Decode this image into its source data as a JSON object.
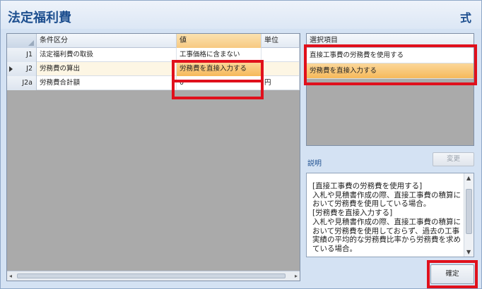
{
  "window": {
    "title": "法定福利費",
    "title_right": "式"
  },
  "grid": {
    "columns": [
      "条件区分",
      "値",
      "単位"
    ],
    "rows": [
      {
        "id": "J1",
        "name": "法定福利費の取扱",
        "value": "工事価格に含まない",
        "unit": ""
      },
      {
        "id": "J2",
        "name": "労務費の算出",
        "value": "労務費を直接入力する",
        "unit": ""
      },
      {
        "id": "J2a",
        "name": "労務費合計額",
        "value": "0",
        "unit": "円"
      }
    ],
    "scroll_left": "◂",
    "scroll_right": "▸"
  },
  "selection": {
    "header": "選択項目",
    "items": [
      "直接工事費の労務費を使用する",
      "労務費を直接入力する"
    ]
  },
  "explanation": {
    "label": "説明",
    "change_button": "変更",
    "text": "[直接工事費の労務費を使用する]\n入札や見積書作成の際、直接工事費の積算において労務費を使用している場合。\n[労務費を直接入力する]\n入札や見積書作成の際、直接工事費の積算において労務費を使用しておらず、過去の工事実績の平均的な労務費比率から労務費を求めている場合。",
    "scroll_up": "▲",
    "scroll_down": "▼"
  },
  "ok_button": "確定",
  "colors": {
    "highlight": "#e0101c",
    "accent": "#f6b95a",
    "title": "#1e4f8f"
  }
}
